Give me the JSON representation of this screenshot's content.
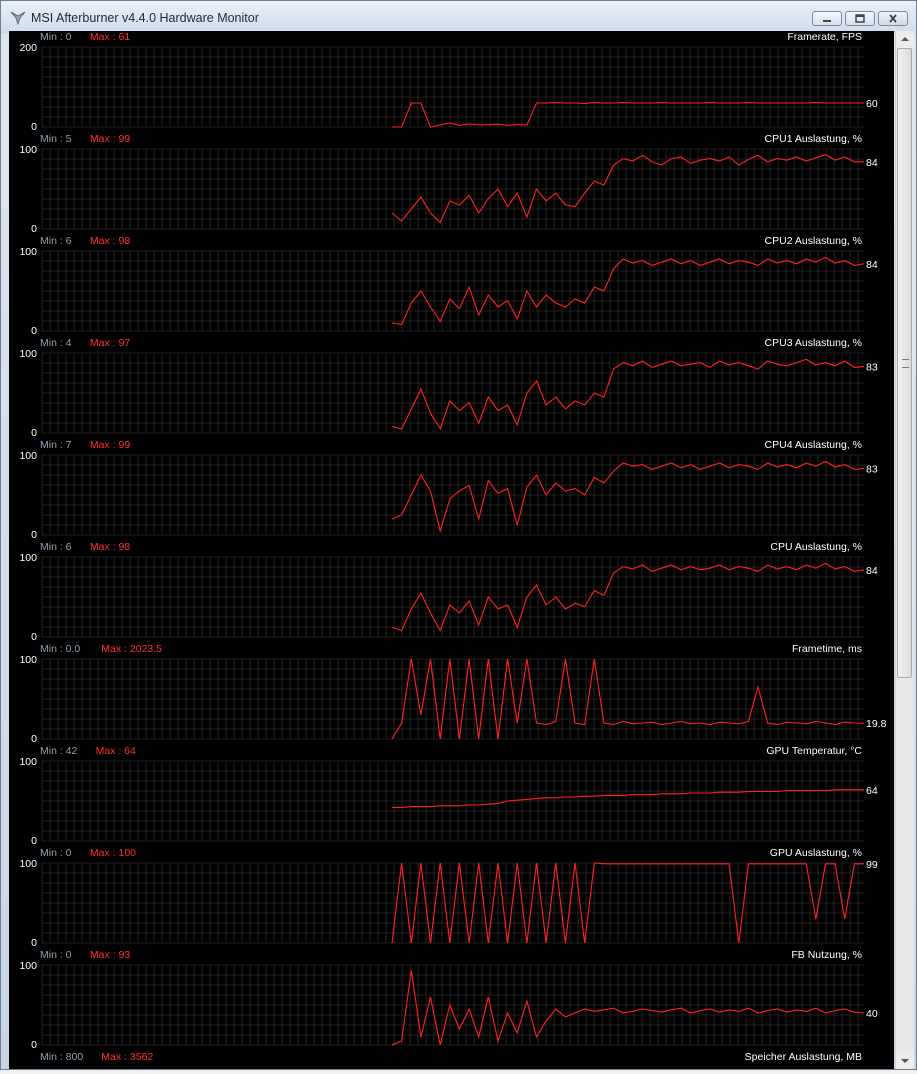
{
  "window": {
    "title": "MSI Afterburner v4.4.0 Hardware Monitor",
    "controls": {
      "minimize_icon": "minimize-icon",
      "restore_icon": "restore-icon",
      "close_icon": "close-icon"
    }
  },
  "colors": {
    "background": "#000000",
    "grid": "#3a3a3a",
    "trace": "#ff2020",
    "min_label": "#8aa0b4",
    "max_label": "#ff3030",
    "text": "#ffffff"
  },
  "panels": [
    {
      "id": "framerate",
      "min_label": "Min : 0",
      "max_label": "Max : 61",
      "title": "Framerate, FPS",
      "y_top": "200",
      "y_bottom": "0",
      "current": "60",
      "ymax": 200
    },
    {
      "id": "cpu1",
      "min_label": "Min : 5",
      "max_label": "Max : 99",
      "title": "CPU1 Auslastung, %",
      "y_top": "100",
      "y_bottom": "0",
      "current": "84",
      "ymax": 100
    },
    {
      "id": "cpu2",
      "min_label": "Min : 6",
      "max_label": "Max : 98",
      "title": "CPU2 Auslastung, %",
      "y_top": "100",
      "y_bottom": "0",
      "current": "84",
      "ymax": 100
    },
    {
      "id": "cpu3",
      "min_label": "Min : 4",
      "max_label": "Max : 97",
      "title": "CPU3 Auslastung, %",
      "y_top": "100",
      "y_bottom": "0",
      "current": "83",
      "ymax": 100
    },
    {
      "id": "cpu4",
      "min_label": "Min : 7",
      "max_label": "Max : 99",
      "title": "CPU4 Auslastung, %",
      "y_top": "100",
      "y_bottom": "0",
      "current": "83",
      "ymax": 100
    },
    {
      "id": "cpu",
      "min_label": "Min : 6",
      "max_label": "Max : 98",
      "title": "CPU Auslastung, %",
      "y_top": "100",
      "y_bottom": "0",
      "current": "84",
      "ymax": 100
    },
    {
      "id": "frametime",
      "min_label": "Min : 0.0",
      "max_label": "Max : 2023.5",
      "title": "Frametime, ms",
      "y_top": "100",
      "y_bottom": "0",
      "current": "19.8",
      "ymax": 100
    },
    {
      "id": "gputemp",
      "min_label": "Min : 42",
      "max_label": "Max : 64",
      "title": "GPU Temperatur, °C",
      "y_top": "100",
      "y_bottom": "0",
      "current": "64",
      "ymax": 100
    },
    {
      "id": "gpuusage",
      "min_label": "Min : 0",
      "max_label": "Max : 100",
      "title": "GPU Auslastung, %",
      "y_top": "100",
      "y_bottom": "0",
      "current": "99",
      "ymax": 100
    },
    {
      "id": "fbusage",
      "min_label": "Min : 0",
      "max_label": "Max : 93",
      "title": "FB Nutzung, %",
      "y_top": "100",
      "y_bottom": "0",
      "current": "40",
      "ymax": 100
    },
    {
      "id": "vram",
      "min_label": "Min : 800",
      "max_label": "Max : 3562",
      "title": "Speicher Auslastung, MB",
      "y_top": "",
      "y_bottom": "",
      "current": "",
      "ymax": 4000
    }
  ],
  "chart_data": [
    {
      "type": "line",
      "title": "Framerate, FPS",
      "ylim": [
        0,
        200
      ],
      "series": [
        {
          "name": "Framerate, FPS",
          "values": [
            0,
            0,
            60,
            60,
            0,
            5,
            10,
            4,
            8,
            5,
            6,
            7,
            4,
            6,
            5,
            60,
            60,
            61,
            60,
            60,
            59,
            61,
            60,
            60,
            61,
            60,
            60,
            60,
            61,
            60,
            60,
            60,
            60,
            61,
            60,
            60,
            60,
            61,
            60,
            60,
            60,
            60,
            60,
            60,
            61,
            60,
            60,
            60,
            60,
            60
          ]
        }
      ]
    },
    {
      "type": "line",
      "title": "CPU1 Auslastung, %",
      "ylim": [
        0,
        100
      ],
      "series": [
        {
          "name": "CPU1 Auslastung, %",
          "values": [
            20,
            10,
            25,
            40,
            20,
            8,
            35,
            30,
            42,
            20,
            38,
            50,
            28,
            45,
            15,
            50,
            35,
            45,
            30,
            28,
            45,
            60,
            55,
            80,
            88,
            85,
            92,
            84,
            80,
            88,
            90,
            82,
            86,
            88,
            85,
            90,
            80,
            87,
            92,
            84,
            88,
            86,
            90,
            85,
            89,
            93,
            86,
            90,
            84,
            84
          ]
        }
      ]
    },
    {
      "type": "line",
      "title": "CPU2 Auslastung, %",
      "ylim": [
        0,
        100
      ],
      "series": [
        {
          "name": "CPU2 Auslastung, %",
          "values": [
            10,
            8,
            35,
            50,
            30,
            12,
            40,
            28,
            55,
            20,
            45,
            30,
            38,
            15,
            50,
            30,
            45,
            35,
            30,
            40,
            35,
            55,
            50,
            78,
            90,
            85,
            88,
            82,
            86,
            90,
            84,
            88,
            82,
            86,
            90,
            84,
            88,
            86,
            82,
            90,
            85,
            88,
            84,
            90,
            86,
            92,
            85,
            88,
            82,
            84
          ]
        }
      ]
    },
    {
      "type": "line",
      "title": "CPU3 Auslastung, %",
      "ylim": [
        0,
        100
      ],
      "series": [
        {
          "name": "CPU3 Auslastung, %",
          "values": [
            8,
            5,
            30,
            55,
            25,
            5,
            40,
            28,
            38,
            12,
            45,
            28,
            35,
            10,
            50,
            65,
            35,
            45,
            30,
            40,
            35,
            50,
            45,
            80,
            88,
            84,
            90,
            82,
            86,
            90,
            84,
            86,
            88,
            82,
            90,
            85,
            88,
            84,
            80,
            90,
            86,
            84,
            88,
            92,
            85,
            88,
            84,
            90,
            82,
            83
          ]
        }
      ]
    },
    {
      "type": "line",
      "title": "CPU4 Auslastung, %",
      "ylim": [
        0,
        100
      ],
      "series": [
        {
          "name": "CPU4 Auslastung, %",
          "values": [
            20,
            25,
            50,
            75,
            55,
            5,
            45,
            55,
            62,
            20,
            68,
            52,
            58,
            12,
            60,
            75,
            50,
            65,
            55,
            58,
            50,
            72,
            65,
            80,
            90,
            86,
            88,
            82,
            86,
            90,
            84,
            88,
            82,
            86,
            90,
            84,
            88,
            86,
            82,
            90,
            85,
            88,
            84,
            90,
            86,
            92,
            85,
            88,
            82,
            83
          ]
        }
      ]
    },
    {
      "type": "line",
      "title": "CPU Auslastung, %",
      "ylim": [
        0,
        100
      ],
      "series": [
        {
          "name": "CPU Auslastung, %",
          "values": [
            12,
            8,
            35,
            55,
            30,
            8,
            40,
            30,
            45,
            15,
            50,
            35,
            40,
            12,
            50,
            65,
            40,
            50,
            35,
            42,
            38,
            58,
            52,
            80,
            88,
            85,
            90,
            82,
            86,
            90,
            84,
            88,
            84,
            86,
            90,
            84,
            88,
            86,
            82,
            90,
            85,
            88,
            84,
            90,
            86,
            92,
            85,
            88,
            82,
            84
          ]
        }
      ]
    },
    {
      "type": "line",
      "title": "Frametime, ms",
      "ylim": [
        0,
        100
      ],
      "series": [
        {
          "name": "Frametime, ms",
          "values": [
            0,
            20,
            100,
            30,
            100,
            0,
            100,
            0,
            100,
            0,
            100,
            0,
            100,
            20,
            100,
            20,
            18,
            22,
            100,
            20,
            18,
            100,
            20,
            18,
            22,
            19,
            20,
            21,
            18,
            20,
            22,
            19,
            20,
            18,
            21,
            20,
            19,
            22,
            65,
            20,
            18,
            21,
            20,
            19,
            22,
            20,
            18,
            21,
            20,
            19.8
          ]
        }
      ]
    },
    {
      "type": "line",
      "title": "GPU Temperatur, °C",
      "ylim": [
        0,
        100
      ],
      "series": [
        {
          "name": "GPU Temperatur, °C",
          "values": [
            42,
            42,
            43,
            43,
            43,
            44,
            44,
            44,
            45,
            45,
            46,
            47,
            50,
            51,
            52,
            53,
            54,
            54,
            55,
            55,
            56,
            56,
            57,
            57,
            57,
            58,
            58,
            58,
            59,
            59,
            59,
            60,
            60,
            60,
            61,
            61,
            61,
            62,
            62,
            62,
            62,
            63,
            63,
            63,
            63,
            63,
            64,
            64,
            64,
            64
          ]
        }
      ]
    },
    {
      "type": "line",
      "title": "GPU Auslastung, %",
      "ylim": [
        0,
        100
      ],
      "series": [
        {
          "name": "GPU Auslastung, %",
          "values": [
            0,
            100,
            0,
            100,
            0,
            100,
            0,
            100,
            0,
            100,
            0,
            100,
            0,
            100,
            0,
            100,
            0,
            100,
            0,
            100,
            0,
            100,
            99,
            99,
            99,
            99,
            99,
            99,
            99,
            99,
            99,
            99,
            99,
            99,
            99,
            99,
            0,
            99,
            99,
            99,
            99,
            99,
            99,
            99,
            30,
            99,
            99,
            30,
            99,
            99
          ]
        }
      ]
    },
    {
      "type": "line",
      "title": "FB Nutzung, %",
      "ylim": [
        0,
        100
      ],
      "series": [
        {
          "name": "FB Nutzung, %",
          "values": [
            0,
            5,
            93,
            10,
            60,
            0,
            50,
            20,
            45,
            10,
            60,
            5,
            40,
            15,
            55,
            10,
            30,
            45,
            35,
            40,
            45,
            42,
            44,
            46,
            40,
            42,
            45,
            43,
            41,
            44,
            46,
            40,
            43,
            45,
            41,
            44,
            42,
            46,
            40,
            43,
            45,
            41,
            44,
            42,
            46,
            40,
            43,
            45,
            41,
            40
          ]
        }
      ]
    }
  ]
}
